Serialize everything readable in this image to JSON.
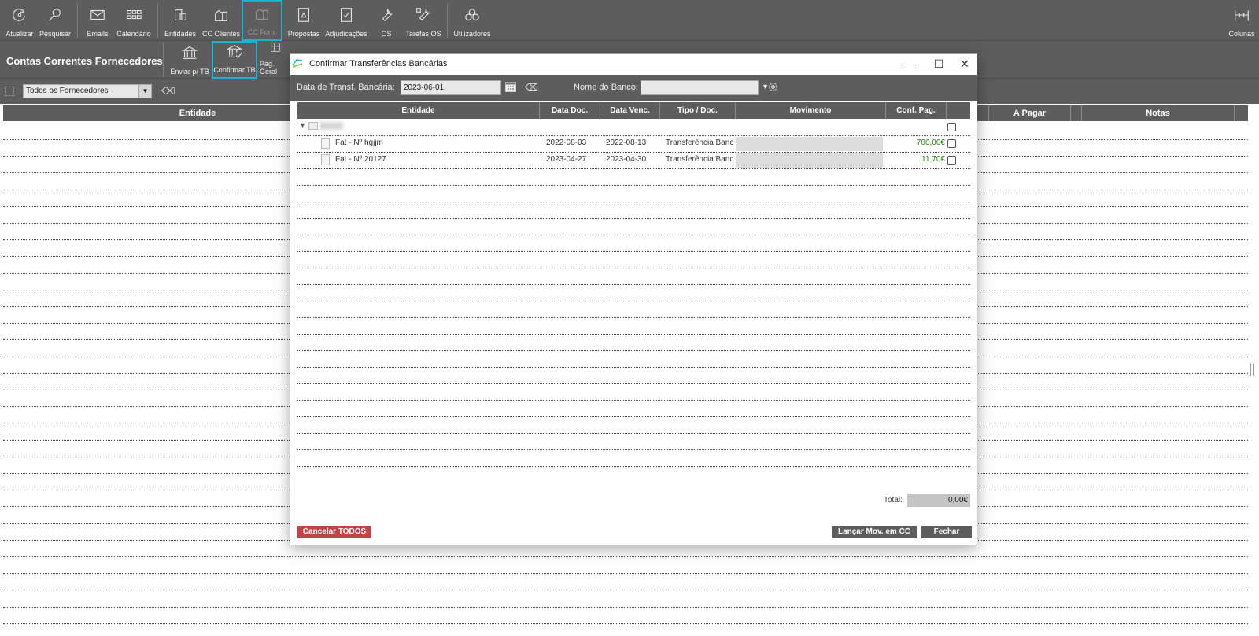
{
  "toolbar": {
    "items": [
      {
        "label": "Atualizar",
        "icon": "refresh-icon"
      },
      {
        "label": "Pesquisar",
        "icon": "search-icon"
      },
      {
        "label": "Emails",
        "icon": "mail-icon"
      },
      {
        "label": "Calendário",
        "icon": "calendar-grid-icon"
      },
      {
        "label": "Entidades",
        "icon": "entities-icon"
      },
      {
        "label": "CC Clientes",
        "icon": "clients-account-icon"
      },
      {
        "label": "CC Forn.",
        "icon": "suppliers-account-icon"
      },
      {
        "label": "Propostas",
        "icon": "proposal-icon"
      },
      {
        "label": "Adjudicações",
        "icon": "checkbox-doc-icon"
      },
      {
        "label": "OS",
        "icon": "wrench-icon"
      },
      {
        "label": "Tarefas OS",
        "icon": "tools-icon"
      },
      {
        "label": "Utilizadores",
        "icon": "users-icon"
      },
      {
        "label": "Colunas",
        "icon": "columns-icon"
      }
    ]
  },
  "subbar": {
    "title": "Contas Correntes Fornecedores",
    "items": [
      {
        "label": "Enviar p/ TB",
        "icon": "bank-icon"
      },
      {
        "label": "Confirmar TB",
        "icon": "bank-check-icon"
      },
      {
        "label": "Pag. Geral",
        "icon": "spreadsheet-icon"
      }
    ]
  },
  "filter": {
    "supplier": "Todos os Fornecedores"
  },
  "main_grid": {
    "columns": [
      "Entidade",
      "A Pagar",
      "Notas"
    ]
  },
  "modal": {
    "title": "Confirmar Transferências Bancárias",
    "date_label": "Data de Transf. Bancária:",
    "date_value": "2023-06-01",
    "bank_label": "Nome do Banco:",
    "bank_value": "",
    "columns": {
      "entidade": "Entidade",
      "data_doc": "Data Doc.",
      "data_venc": "Data Venc.",
      "tipo_doc": "Tipo / Doc.",
      "movimento": "Movimento",
      "conf_pag": "Conf. Pag."
    },
    "rows": [
      {
        "entidade": "Fat  - Nº hgjjm",
        "data_doc": "2022-08-03",
        "data_venc": "2022-08-13",
        "tipo": "Transferência Banc",
        "amount": "700,00€"
      },
      {
        "entidade": "Fat  - Nº 20127",
        "data_doc": "2023-04-27",
        "data_venc": "2023-04-30",
        "tipo": "Transferência Banc",
        "amount": "11,70€"
      }
    ],
    "total_label": "Total:",
    "total_value": "0,00€",
    "buttons": {
      "cancel_all": "Cancelar TODOS",
      "launch": "Lançar Mov. em CC",
      "close": "Fechar"
    }
  },
  "colors": {
    "toolbar_bg": "#5d5d5d",
    "highlight": "#1fb2c8",
    "cancel_button": "#c04444",
    "amount_text": "#2e7d1b"
  }
}
